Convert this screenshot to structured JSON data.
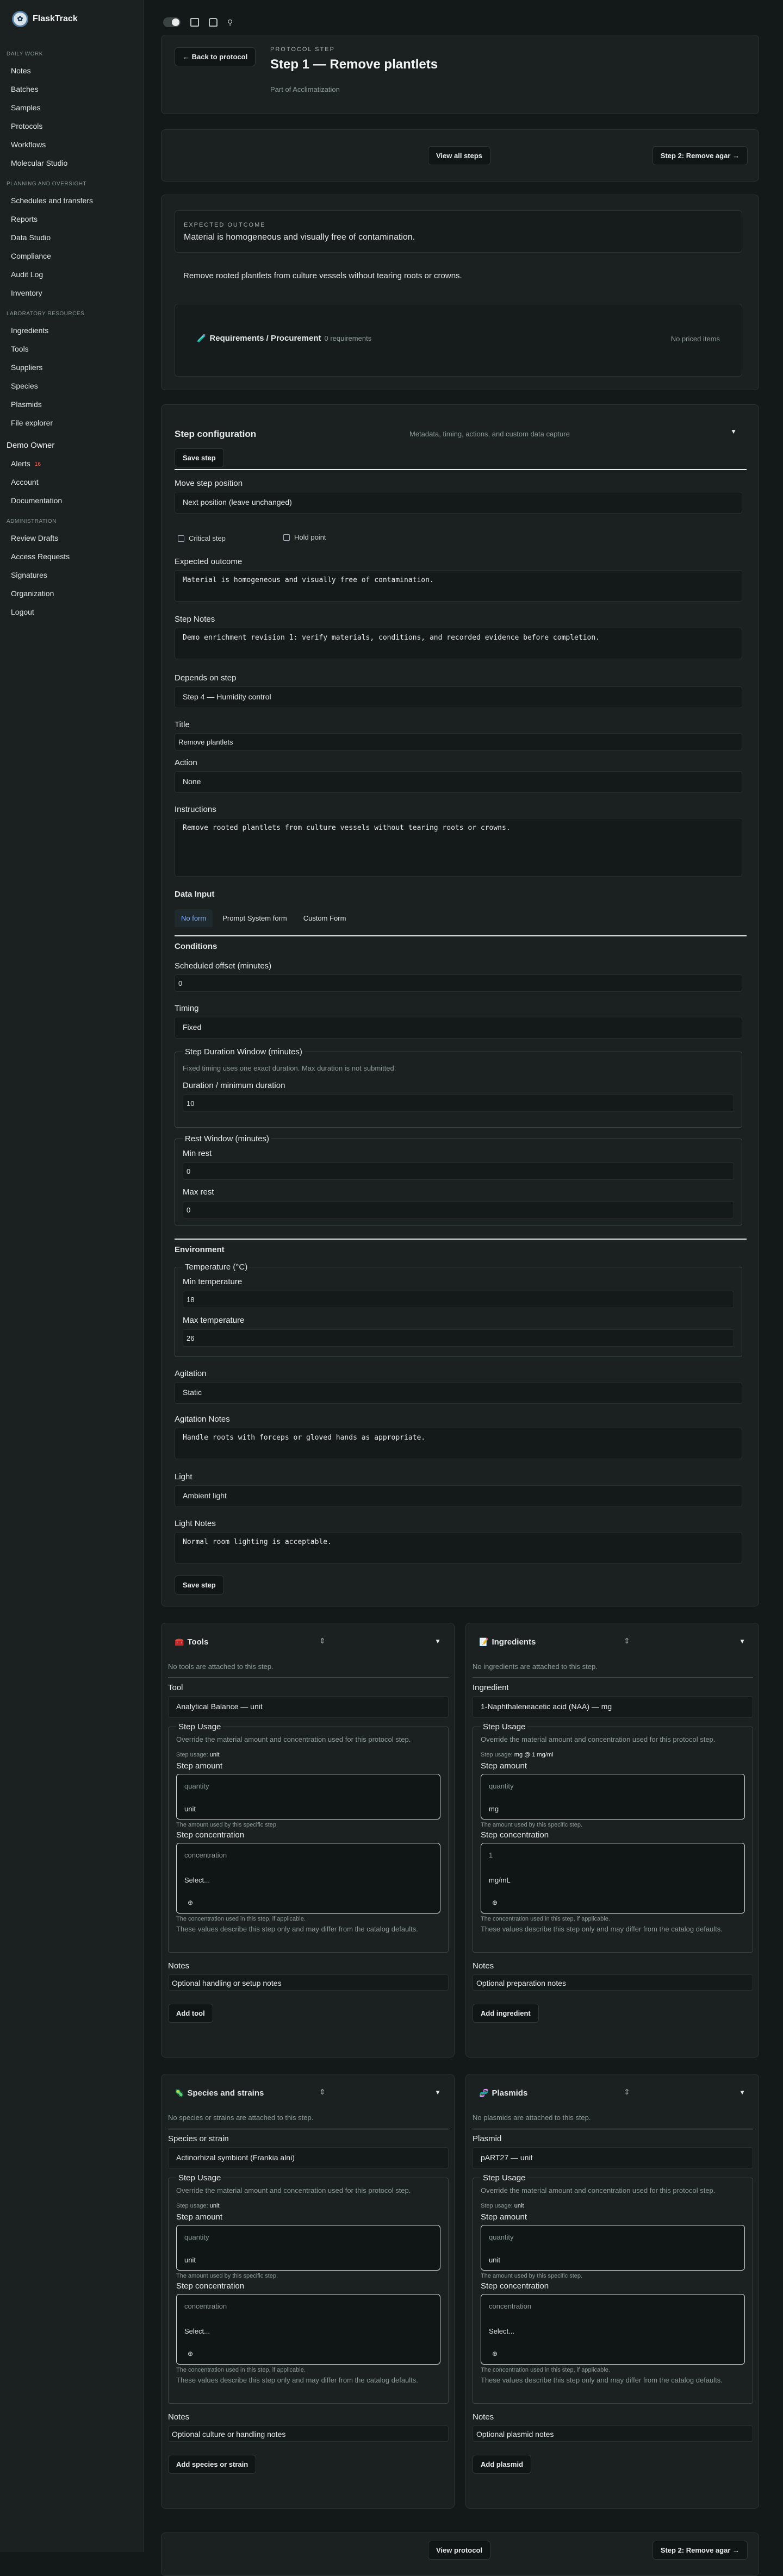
{
  "app": {
    "name": "FlaskTrack"
  },
  "sidebar": {
    "daily": {
      "title": "DAILY WORK",
      "items": [
        "Notes",
        "Batches",
        "Samples",
        "Protocols",
        "Workflows",
        "Molecular Studio"
      ]
    },
    "planning": {
      "title": "PLANNING AND OVERSIGHT",
      "items": [
        "Schedules and transfers",
        "Reports",
        "Data Studio",
        "Compliance",
        "Audit Log",
        "Inventory"
      ]
    },
    "lab": {
      "title": "LABORATORY RESOURCES",
      "items": [
        "Ingredients",
        "Tools",
        "Suppliers",
        "Species",
        "Plasmids",
        "File explorer"
      ]
    },
    "user": "Demo Owner",
    "user_items": [
      "Alerts",
      "Account",
      "Documentation"
    ],
    "alerts_badge": "16",
    "admin": {
      "title": "ADMINISTRATION",
      "items": [
        "Review Drafts",
        "Access Requests",
        "Signatures",
        "Organization",
        "Logout"
      ]
    }
  },
  "header": {
    "back": "← Back to protocol",
    "eyebrow": "PROTOCOL STEP",
    "title": "Step 1 — Remove plantlets",
    "subtitle": "Part of Acclimatization"
  },
  "nav": {
    "view_all": "View all steps",
    "next": "Step 2: Remove agar →"
  },
  "outcome": {
    "label": "EXPECTED OUTCOME",
    "text": "Material is homogeneous and visually free of contamination.",
    "instructions": "Remove rooted plantlets from culture vessels without tearing roots or crowns."
  },
  "requirements": {
    "title": "Requirements / Procurement",
    "count": "0 requirements",
    "priced": "No priced items"
  },
  "config": {
    "title": "Step configuration",
    "meta": "Metadata, timing, actions, and custom data capture",
    "save": "Save step",
    "move_label": "Move step position",
    "move_value": "Next position (leave unchanged)",
    "critical": "Critical step",
    "hold": "Hold point",
    "outcome_label": "Expected outcome",
    "outcome_value": "Material is homogeneous and visually free of contamination.",
    "notes_label": "Step Notes",
    "notes_value": "Demo enrichment revision 1: verify materials, conditions, and recorded evidence before completion.",
    "depends_label": "Depends on step",
    "depends_value": "Step 4 — Humidity control",
    "title_label": "Title",
    "title_value": "Remove plantlets",
    "action_label": "Action",
    "action_value": "None",
    "instr_label": "Instructions",
    "instr_value": "Remove rooted plantlets from culture vessels without tearing roots or crowns.",
    "data_input": "Data Input",
    "tabs": [
      "No form",
      "Prompt System form",
      "Custom Form"
    ],
    "conditions": "Conditions",
    "offset_label": "Scheduled offset (minutes)",
    "offset_value": "0",
    "timing_label": "Timing",
    "timing_value": "Fixed",
    "window_legend": "Step Duration Window (minutes)",
    "window_note": "Fixed timing uses one exact duration. Max duration is not submitted.",
    "duration_label": "Duration / minimum duration",
    "duration_value": "10",
    "rest_legend": "Rest Window (minutes)",
    "min_rest_label": "Min rest",
    "min_rest_value": "0",
    "max_rest_label": "Max rest",
    "max_rest_value": "0",
    "environment": "Environment",
    "temp_legend": "Temperature (°C)",
    "min_temp_label": "Min temperature",
    "min_temp_value": "18",
    "max_temp_label": "Max temperature",
    "max_temp_value": "26",
    "agitation_label": "Agitation",
    "agitation_value": "Static",
    "agitation_notes_label": "Agitation Notes",
    "agitation_notes_value": "Handle roots with forceps or gloved hands as appropriate.",
    "light_label": "Light",
    "light_value": "Ambient light",
    "light_notes_label": "Light Notes",
    "light_notes_value": "Normal room lighting is acceptable.",
    "save_bottom": "Save step"
  },
  "tools": {
    "title": "Tools",
    "empty": "No tools are attached to this step.",
    "select_label": "Tool",
    "select_value": "Analytical Balance — unit",
    "usage_legend": "Step Usage",
    "usage_desc": "Override the material amount and concentration used for this protocol step.",
    "usage_meta": "Step usage: ",
    "usage_meta_val": "unit",
    "amount_label": "Step amount",
    "amount_ph": "quantity",
    "amount_unit": "unit",
    "amount_help": "The amount used by this specific step.",
    "conc_label": "Step concentration",
    "conc_ph": "concentration",
    "conc_unit": "Select...",
    "conc_help": "The concentration used in this step, if applicable.",
    "catalog_help": "These values describe this step only and may differ from the catalog defaults.",
    "notes_label": "Notes",
    "notes_ph": "Optional handling or setup notes",
    "add": "Add tool"
  },
  "ingredients": {
    "title": "Ingredients",
    "empty": "No ingredients are attached to this step.",
    "select_label": "Ingredient",
    "select_value": "1-Naphthaleneacetic acid (NAA) — mg",
    "usage_legend": "Step Usage",
    "usage_desc": "Override the material amount and concentration used for this protocol step.",
    "usage_meta": "Step usage: ",
    "usage_meta_val": "mg @ 1 mg/ml",
    "amount_label": "Step amount",
    "amount_ph": "quantity",
    "amount_unit": "mg",
    "amount_help": "The amount used by this specific step.",
    "conc_label": "Step concentration",
    "conc_ph": "1",
    "conc_unit": "mg/mL",
    "conc_help": "The concentration used in this step, if applicable.",
    "catalog_help": "These values describe this step only and may differ from the catalog defaults.",
    "notes_label": "Notes",
    "notes_ph": "Optional preparation notes",
    "add": "Add ingredient"
  },
  "species": {
    "title": "Species and strains",
    "empty": "No species or strains are attached to this step.",
    "select_label": "Species or strain",
    "select_value": "Actinorhizal symbiont (Frankia alni)",
    "usage_legend": "Step Usage",
    "usage_desc": "Override the material amount and concentration used for this protocol step.",
    "usage_meta": "Step usage: ",
    "usage_meta_val": "unit",
    "amount_label": "Step amount",
    "amount_ph": "quantity",
    "amount_unit": "unit",
    "amount_help": "The amount used by this specific step.",
    "conc_label": "Step concentration",
    "conc_ph": "concentration",
    "conc_unit": "Select...",
    "conc_help": "The concentration used in this step, if applicable.",
    "catalog_help": "These values describe this step only and may differ from the catalog defaults.",
    "notes_label": "Notes",
    "notes_ph": "Optional culture or handling notes",
    "add": "Add species or strain"
  },
  "plasmids": {
    "title": "Plasmids",
    "empty": "No plasmids are attached to this step.",
    "select_label": "Plasmid",
    "select_value": "pART27 — unit",
    "usage_legend": "Step Usage",
    "usage_desc": "Override the material amount and concentration used for this protocol step.",
    "usage_meta": "Step usage: ",
    "usage_meta_val": "unit",
    "amount_label": "Step amount",
    "amount_ph": "quantity",
    "amount_unit": "unit",
    "amount_help": "The amount used by this specific step.",
    "conc_label": "Step concentration",
    "conc_ph": "concentration",
    "conc_unit": "Select...",
    "conc_help": "The concentration used in this step, if applicable.",
    "catalog_help": "These values describe this step only and may differ from the catalog defaults.",
    "notes_label": "Notes",
    "notes_ph": "Optional plasmid notes",
    "add": "Add plasmid"
  },
  "footer": {
    "view": "View protocol",
    "next": "Step 2: Remove agar →"
  }
}
